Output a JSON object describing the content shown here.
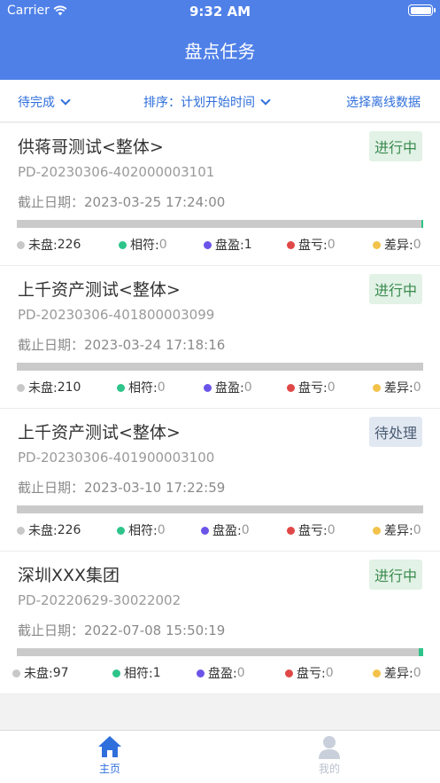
{
  "status_bar": {
    "carrier": "Carrier",
    "time": "9:32 AM"
  },
  "header": {
    "title": "盘点任务"
  },
  "filters": {
    "status": "待完成",
    "sort": "排序：计划开始时间",
    "offline": "选择离线数据"
  },
  "colors": {
    "accent": "#4f80e8",
    "unchecked": "#c8c8c8",
    "matched": "#2ec48a",
    "surplus": "#6b55e8",
    "loss": "#e04848",
    "diff": "#f2c24a"
  },
  "labels": {
    "deadline_prefix": "截止日期：",
    "unchecked": "未盘:",
    "matched": "相符:",
    "surplus": "盘盈:",
    "loss": "盘亏:",
    "diff": "差异:"
  },
  "tasks": [
    {
      "name": "供蒋哥测试<整体>",
      "status": "进行中",
      "code": "PD-20230306-402000003101",
      "deadline": "2023-03-25 17:24:00",
      "progress": 0.0044,
      "unchecked": "226",
      "matched": "0",
      "surplus": "1",
      "loss": "0",
      "diff": "0"
    },
    {
      "name": "上千资产测试<整体>",
      "status": "进行中",
      "code": "PD-20230306-401800003099",
      "deadline": "2023-03-24 17:18:16",
      "progress": 0,
      "unchecked": "210",
      "matched": "0",
      "surplus": "0",
      "loss": "0",
      "diff": "0"
    },
    {
      "name": "上千资产测试<整体>",
      "status": "待处理",
      "code": "PD-20230306-401900003100",
      "deadline": "2023-03-10 17:22:59",
      "progress": 0,
      "unchecked": "226",
      "matched": "0",
      "surplus": "0",
      "loss": "0",
      "diff": "0"
    },
    {
      "name": "深圳XXX集团",
      "status": "进行中",
      "code": "PD-20220629-30022002",
      "deadline": "2022-07-08 15:50:19",
      "progress": 0.0102,
      "unchecked": "97",
      "matched": "1",
      "surplus": "0",
      "loss": "0",
      "diff": "0"
    }
  ],
  "tabbar": {
    "home": {
      "label": "主页",
      "icon": "home-icon"
    },
    "mine": {
      "label": "我的",
      "icon": "user-icon"
    }
  }
}
